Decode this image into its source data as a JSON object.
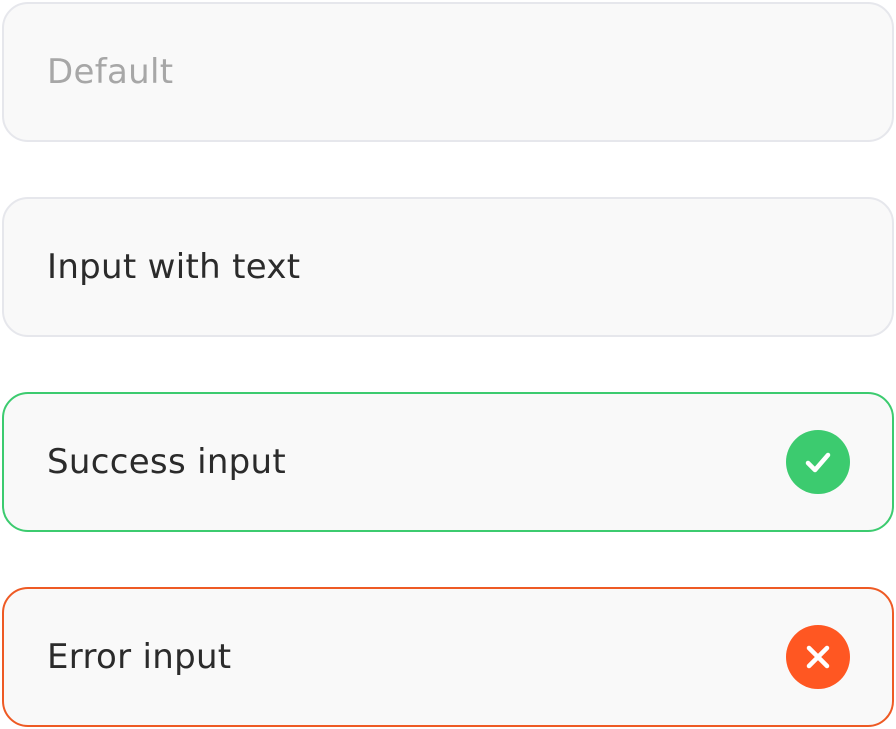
{
  "fields": {
    "default": {
      "placeholder": "Default",
      "value": ""
    },
    "with_text": {
      "value": "Input with text"
    },
    "success": {
      "value": "Success input",
      "state": "success",
      "icon": "check-circle-icon",
      "color": "#3ccb6f"
    },
    "error": {
      "value": "Error input",
      "state": "error",
      "icon": "x-circle-icon",
      "color": "#ff5722"
    }
  },
  "colors": {
    "field_background": "#f9f9f9",
    "default_border": "#e6e7ec",
    "success_border": "#3ccb6f",
    "error_border": "#ee5a24",
    "text": "#2b2b2b",
    "placeholder": "#a7a7a7"
  }
}
